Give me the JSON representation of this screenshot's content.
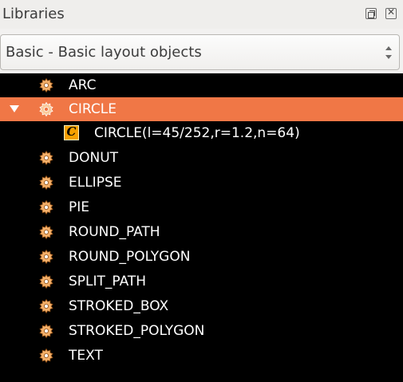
{
  "panel": {
    "title": "Libraries"
  },
  "library_select": {
    "value": "Basic - Basic layout objects"
  },
  "tree": {
    "items": [
      {
        "label": "ARC",
        "icon": "gear-icon",
        "expanded": false,
        "selected": false
      },
      {
        "label": "CIRCLE",
        "icon": "gear-icon",
        "expanded": true,
        "selected": true,
        "children": [
          {
            "label": "CIRCLE(l=45/252,r=1.2,n=64)",
            "icon": "c-component-icon",
            "icon_letter": "C"
          }
        ]
      },
      {
        "label": "DONUT",
        "icon": "gear-icon",
        "expanded": false,
        "selected": false
      },
      {
        "label": "ELLIPSE",
        "icon": "gear-icon",
        "expanded": false,
        "selected": false
      },
      {
        "label": "PIE",
        "icon": "gear-icon",
        "expanded": false,
        "selected": false
      },
      {
        "label": "ROUND_PATH",
        "icon": "gear-icon",
        "expanded": false,
        "selected": false
      },
      {
        "label": "ROUND_POLYGON",
        "icon": "gear-icon",
        "expanded": false,
        "selected": false
      },
      {
        "label": "SPLIT_PATH",
        "icon": "gear-icon",
        "expanded": false,
        "selected": false
      },
      {
        "label": "STROKED_BOX",
        "icon": "gear-icon",
        "expanded": false,
        "selected": false
      },
      {
        "label": "STROKED_POLYGON",
        "icon": "gear-icon",
        "expanded": false,
        "selected": false
      },
      {
        "label": "TEXT",
        "icon": "gear-icon",
        "expanded": false,
        "selected": false
      }
    ]
  },
  "colors": {
    "selection": "#f07746",
    "tree_background": "#000000",
    "gear_fill": "#f4b06a",
    "component_icon": "#f5a000"
  }
}
